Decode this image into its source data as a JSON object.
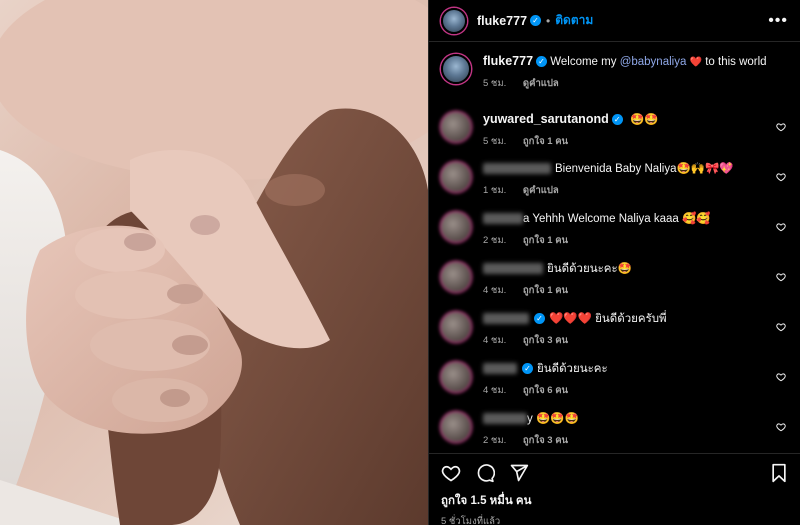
{
  "post": {
    "author": "fluke777",
    "follow_label": "ติดตาม",
    "more_label": "•••",
    "caption": {
      "username": "fluke777",
      "text_before": "Welcome my ",
      "mention": "@babynaliya",
      "emoji": "❤️",
      "text_after": " to this world",
      "time": "5 ชม.",
      "translate": "ดูคำแปล"
    }
  },
  "comments": [
    {
      "username": "yuwared_sarutanond",
      "text": "🤩🤩",
      "time": "5 ชม.",
      "action": "ถูกใจ 1 คน",
      "verified": true
    },
    {
      "username": "",
      "text": "Bienvenida Baby Naliya🤩🙌🎀💖",
      "time": "1 ชม.",
      "action": "ดูคำแปล",
      "verified": false
    },
    {
      "username": "",
      "text": "a Yehhh Welcome Naliya kaaa 🥰🥰",
      "time": "2 ชม.",
      "action": "ถูกใจ 1 คน",
      "verified": false
    },
    {
      "username": "",
      "text": "ยินดีด้วยนะคะ🤩",
      "time": "4 ชม.",
      "action": "ถูกใจ 1 คน",
      "verified": false
    },
    {
      "username": "",
      "text": "❤️❤️❤️ ยินดีด้วยครับพี่",
      "time": "4 ชม.",
      "action": "ถูกใจ 3 คน",
      "verified": true
    },
    {
      "username": "",
      "text": "ยินดีด้วยนะคะ",
      "time": "4 ชม.",
      "action": "ถูกใจ 6 คน",
      "verified": true
    },
    {
      "username": "",
      "text": "y 🤩🤩🤩",
      "time": "2 ชม.",
      "action": "ถูกใจ 3 คน",
      "verified": true
    }
  ],
  "footer": {
    "likes": "ถูกใจ 1.5 หมื่น คน",
    "time_ago": "5 ชั่วโมงที่แล้ว"
  },
  "icons": {
    "like": "heart-icon",
    "comment": "comment-icon",
    "share": "share-icon",
    "save": "bookmark-icon",
    "verified": "verified-badge-icon"
  },
  "colors": {
    "background": "#000000",
    "link": "#0095f6",
    "mention": "#8fa8e8",
    "muted": "#a8a8a8",
    "story_ring": "#c13584"
  }
}
